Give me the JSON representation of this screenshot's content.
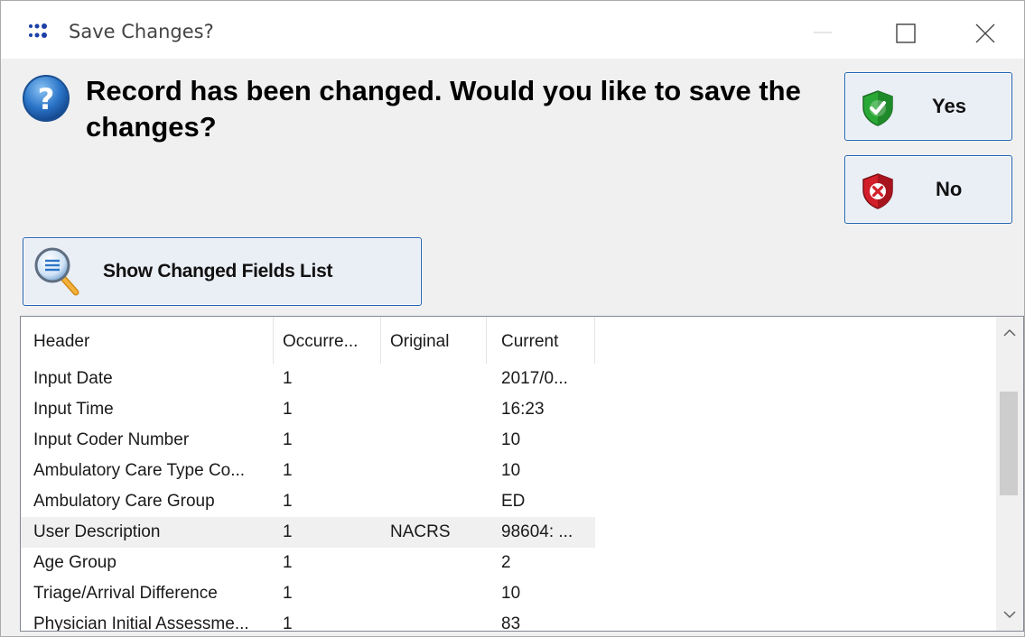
{
  "window": {
    "title": "Save Changes?",
    "icon": "dots-app-icon"
  },
  "message": {
    "icon": "question-icon",
    "text": "Record has been changed. Would you like to save the changes?"
  },
  "buttons": {
    "yes_label": "Yes",
    "no_label": "No",
    "show_fields_label": "Show Changed Fields List"
  },
  "list": {
    "columns": [
      "Header",
      "Occurre...",
      "Original",
      "Current"
    ],
    "rows": [
      {
        "header": "Input Date",
        "occurrence": "1",
        "original": "",
        "current": "2017/0..."
      },
      {
        "header": "Input Time",
        "occurrence": "1",
        "original": "",
        "current": "16:23"
      },
      {
        "header": "Input Coder Number",
        "occurrence": "1",
        "original": "",
        "current": "10"
      },
      {
        "header": "Ambulatory Care Type Co...",
        "occurrence": "1",
        "original": "",
        "current": "10"
      },
      {
        "header": "Ambulatory Care Group",
        "occurrence": "1",
        "original": "",
        "current": "ED"
      },
      {
        "header": "User Description",
        "occurrence": "1",
        "original": "NACRS",
        "current": "98604: ...",
        "selected": true
      },
      {
        "header": "Age Group",
        "occurrence": "1",
        "original": "",
        "current": "2"
      },
      {
        "header": "Triage/Arrival Difference",
        "occurrence": "1",
        "original": "",
        "current": "10"
      },
      {
        "header": "Physician Initial Assessme...",
        "occurrence": "1",
        "original": "",
        "current": "83"
      }
    ]
  },
  "colors": {
    "button_border": "#1e62b0",
    "button_bg": "#eaeef5",
    "dialog_bg": "#f0f0f0",
    "selected_row_bg": "#f0f0f0"
  }
}
